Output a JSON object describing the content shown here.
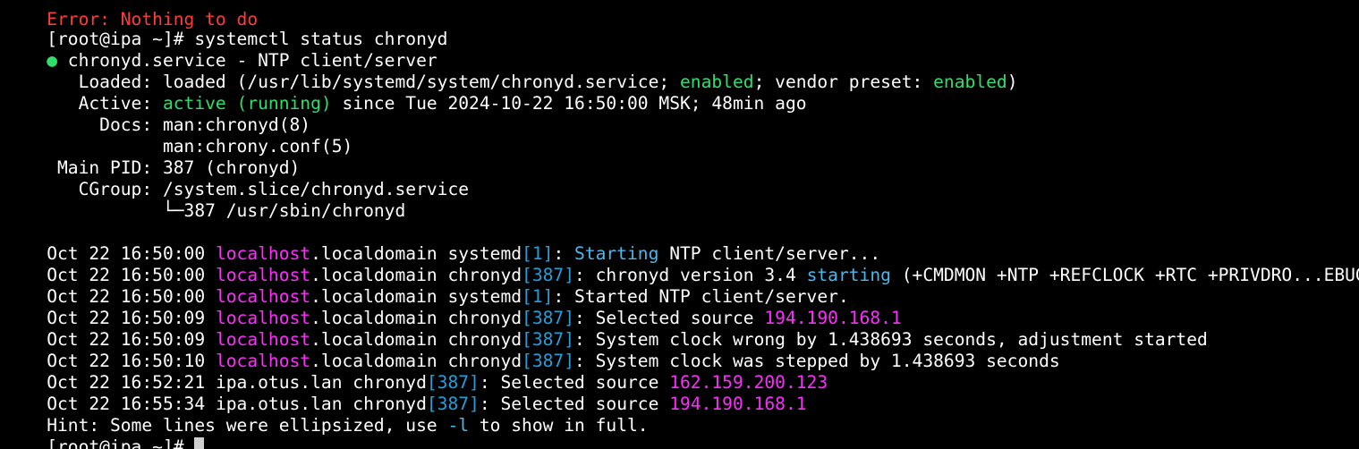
{
  "terminal": {
    "colors": {
      "background": "#000000",
      "foreground": "#ffffff",
      "green": "#2ee06a",
      "blue": "#1fa0df",
      "magenta": "#ff2cff"
    },
    "cut_line": "Error: Nothing to do",
    "prompt_command": "[root@ipa ~]# systemctl status chronyd",
    "status_dot": "●",
    "service_title": " chronyd.service - NTP client/server",
    "loaded_label": "   Loaded: ",
    "loaded_pre": "loaded (/usr/lib/systemd/system/chronyd.service; ",
    "loaded_enabled": "enabled",
    "loaded_mid": "; vendor preset: ",
    "loaded_preset": "enabled",
    "loaded_end": ")",
    "active_label": "   Active: ",
    "active_state": "active (running)",
    "active_since": " since Tue 2024-10-22 16:50:00 MSK; 48min ago",
    "docs_label": "     Docs: ",
    "docs_1": "man:chronyd(8)",
    "docs_2": "           man:chrony.conf(5)",
    "mainpid_label": " Main PID: ",
    "mainpid_value": "387 (chronyd)",
    "cgroup_label": "   CGroup: ",
    "cgroup_value": "/system.slice/chronyd.service",
    "cgroup_tree": "           └─387 /usr/sbin/chronyd",
    "log": [
      {
        "time": "Oct 22 16:50:00 ",
        "host_hl": "localhost",
        "host_rest": ".localdomain ",
        "proc": "systemd",
        "pid": "[1]",
        "sep": ": ",
        "msg_hl": "Starting",
        "msg_rest": " NTP client/server...",
        "ip": ""
      },
      {
        "time": "Oct 22 16:50:00 ",
        "host_hl": "localhost",
        "host_rest": ".localdomain ",
        "proc": "chronyd",
        "pid": "[387]",
        "sep": ": ",
        "msg_pre": "chronyd version 3.4 ",
        "msg_hl": "starting",
        "msg_rest": " (+CMDMON +NTP +REFCLOCK +RTC +PRIVDRO...EBUG)",
        "ip": ""
      },
      {
        "time": "Oct 22 16:50:00 ",
        "host_hl": "localhost",
        "host_rest": ".localdomain ",
        "proc": "systemd",
        "pid": "[1]",
        "sep": ": ",
        "msg_rest": "Started NTP client/server.",
        "ip": ""
      },
      {
        "time": "Oct 22 16:50:09 ",
        "host_hl": "localhost",
        "host_rest": ".localdomain ",
        "proc": "chronyd",
        "pid": "[387]",
        "sep": ": ",
        "msg_rest": "Selected source ",
        "ip": "194.190.168.1"
      },
      {
        "time": "Oct 22 16:50:09 ",
        "host_hl": "localhost",
        "host_rest": ".localdomain ",
        "proc": "chronyd",
        "pid": "[387]",
        "sep": ": ",
        "msg_rest": "System clock wrong by 1.438693 seconds, adjustment started",
        "ip": ""
      },
      {
        "time": "Oct 22 16:50:10 ",
        "host_hl": "localhost",
        "host_rest": ".localdomain ",
        "proc": "chronyd",
        "pid": "[387]",
        "sep": ": ",
        "msg_rest": "System clock was stepped by 1.438693 seconds",
        "ip": ""
      },
      {
        "time": "Oct 22 16:52:21 ",
        "host_hl": "",
        "host_rest": "ipa.otus.lan ",
        "proc": "chronyd",
        "pid": "[387]",
        "sep": ": ",
        "msg_rest": "Selected source ",
        "ip": "162.159.200.123"
      },
      {
        "time": "Oct 22 16:55:34 ",
        "host_hl": "",
        "host_rest": "ipa.otus.lan ",
        "proc": "chronyd",
        "pid": "[387]",
        "sep": ": ",
        "msg_rest": "Selected source ",
        "ip": "194.190.168.1"
      }
    ],
    "hint_pre": "Hint: Some lines were ellipsized, use ",
    "hint_flag": "-l",
    "hint_post": " to show in full.",
    "prompt_final": "[root@ipa ~]# "
  }
}
